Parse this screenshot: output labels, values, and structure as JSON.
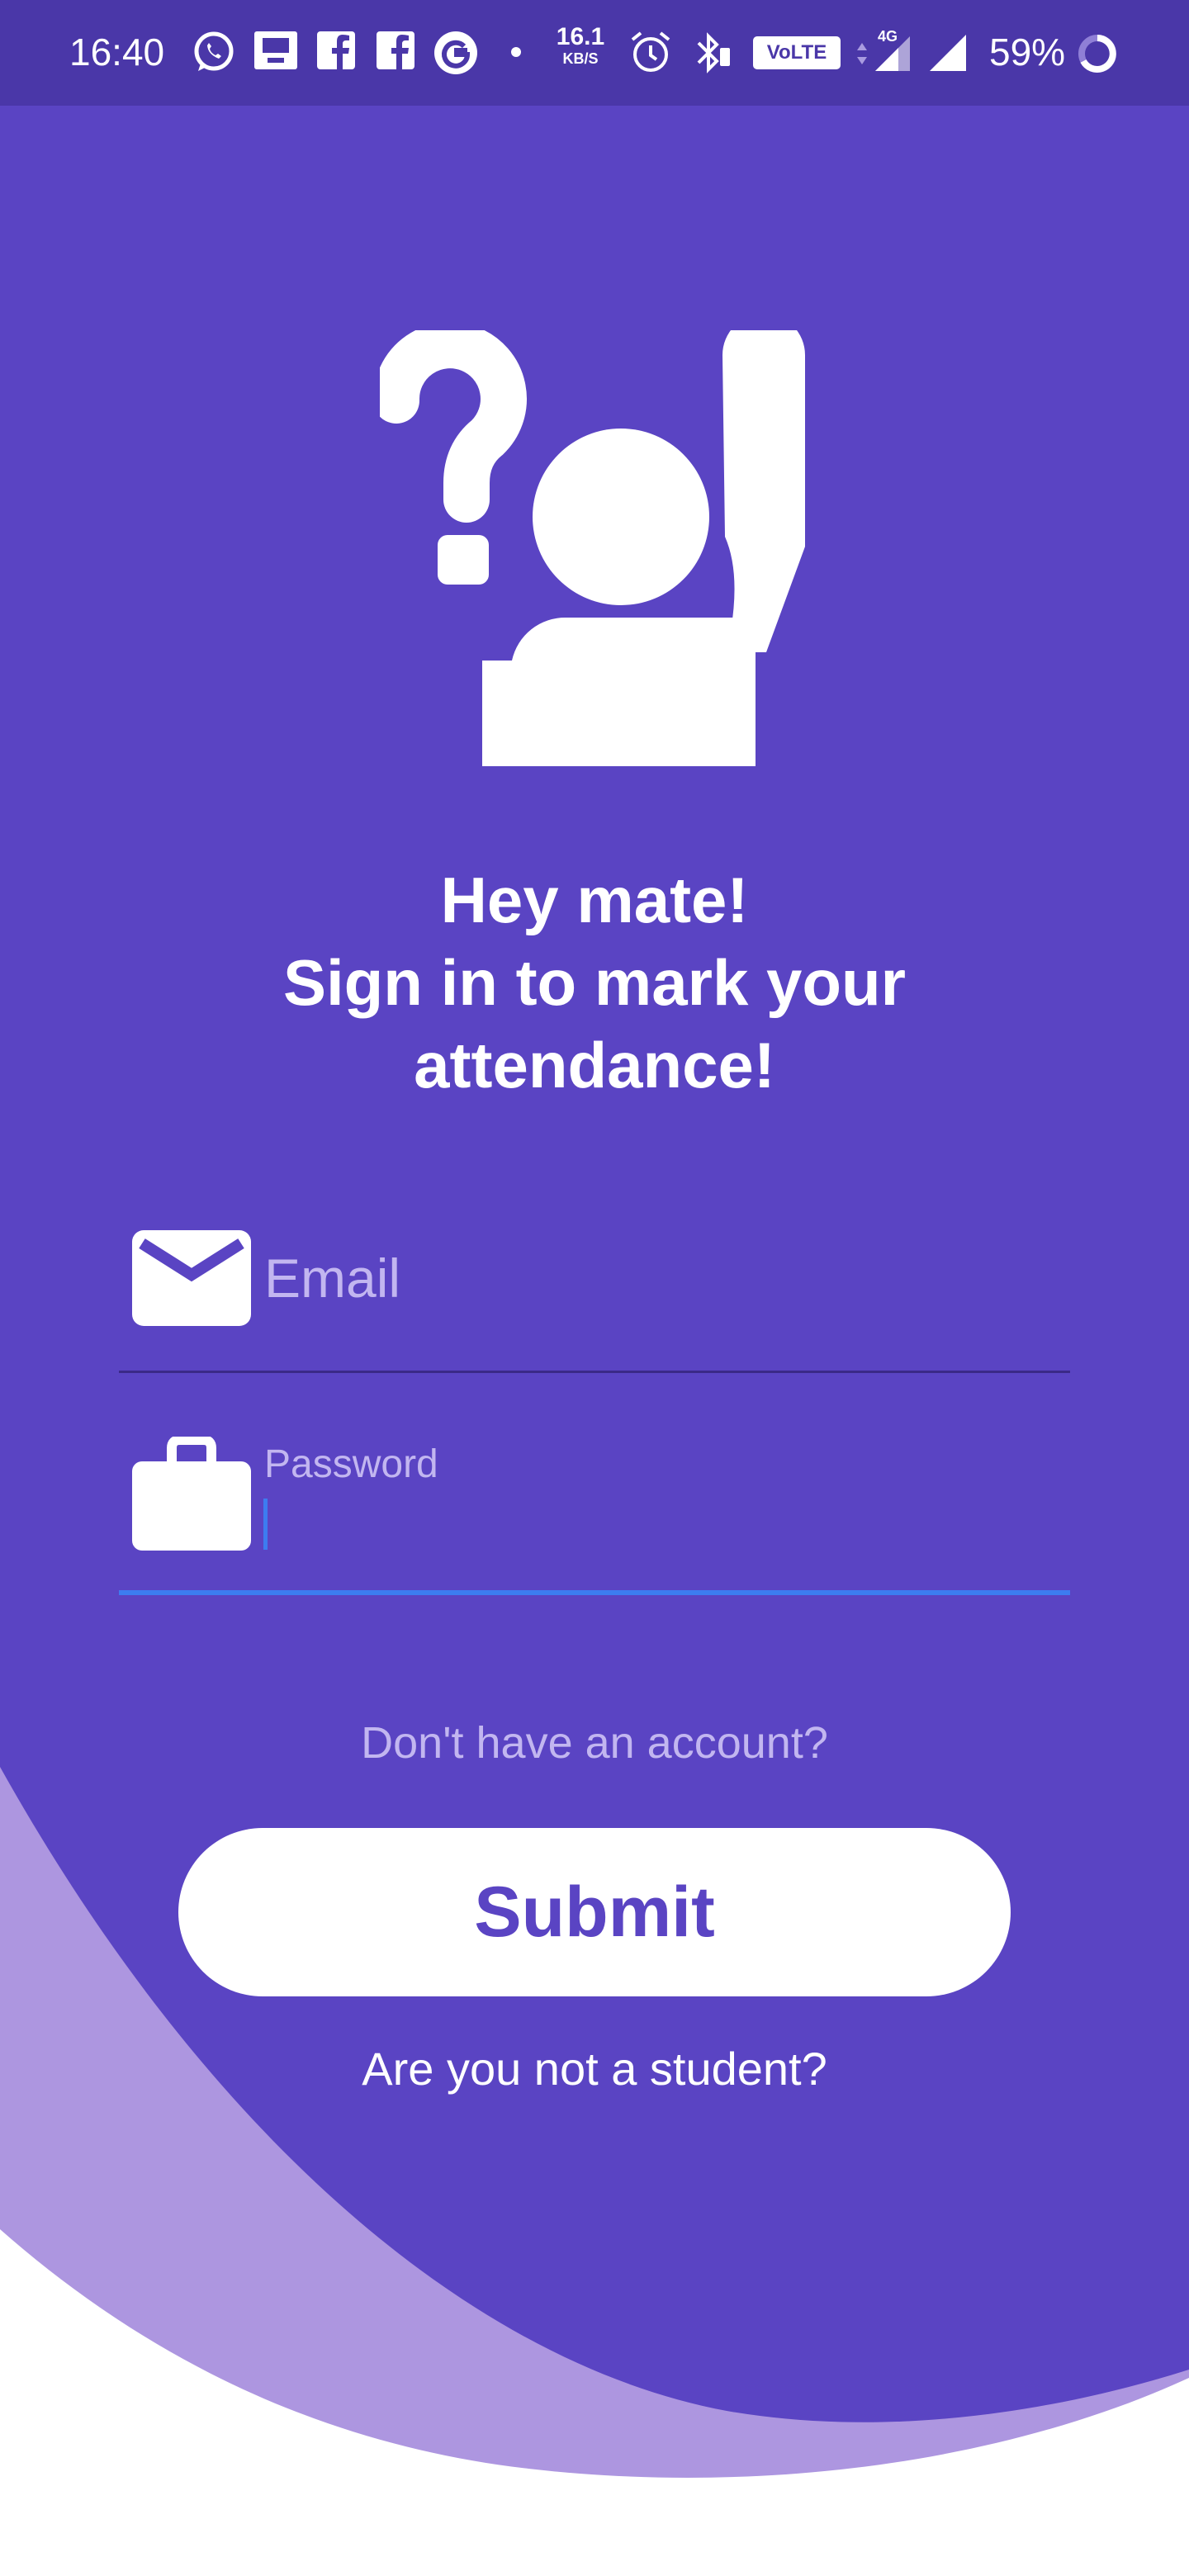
{
  "status_bar": {
    "time": "16:40",
    "net_speed_value": "16.1",
    "net_speed_unit": "KB/S",
    "volte_label": "VoLTE",
    "network_type": "4G",
    "battery_percent": "59%",
    "icons": [
      "whatsapp-icon",
      "presentation-icon",
      "facebook-icon",
      "facebook-icon",
      "google-icon",
      "dot-icon",
      "alarm-icon",
      "bluetooth-icon",
      "signal-icon",
      "signal-icon",
      "battery-icon"
    ]
  },
  "colors": {
    "primary": "#5a44c3",
    "status_bar": "#4a37a8",
    "wave_light": "#ad96e0",
    "accent_focus": "#3d7cf0",
    "hint_text": "#c2b6f0"
  },
  "logo": {
    "icon": "raised-hand-question-icon"
  },
  "headline": {
    "line1": "Hey mate!",
    "line2": "Sign in to mark your",
    "line3": "attendance!"
  },
  "form": {
    "email": {
      "icon": "mail-icon",
      "placeholder": "Email",
      "value": ""
    },
    "password": {
      "icon": "briefcase-icon",
      "label": "Password",
      "value": ""
    }
  },
  "links": {
    "no_account": "Don't have an account?",
    "not_student": "Are you not a student?"
  },
  "buttons": {
    "submit": "Submit"
  }
}
